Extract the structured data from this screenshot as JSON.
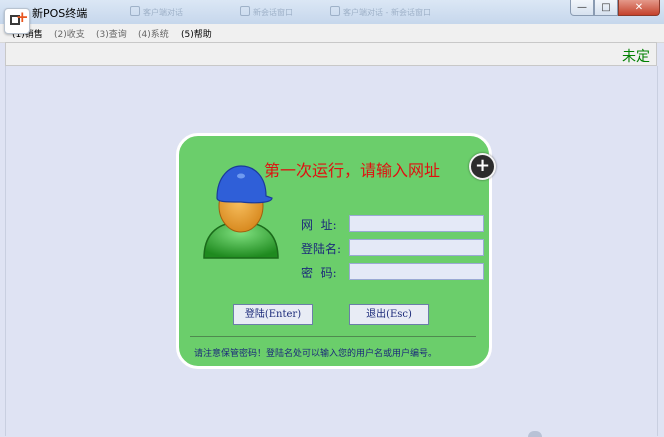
{
  "window": {
    "title": "新POS终端",
    "ghost_tabs": [
      "客户端对话",
      "新会话窗口",
      "客户端对话 - 新会话窗口",
      "客户端对话 - 新会话窗口"
    ],
    "controls": {
      "minimize": "—",
      "maximize": "□",
      "close": "✕"
    }
  },
  "menu": {
    "items": [
      "(1)销售",
      "(2)收支",
      "(3)查询",
      "(4)系统",
      "(5)帮助"
    ]
  },
  "status": {
    "text": "未定"
  },
  "login": {
    "title": "第一次运行，请输入网址",
    "fields": {
      "url_label": "网  址:",
      "url_value": "",
      "username_label": "登陆名:",
      "username_value": "",
      "password_label": "密  码:",
      "password_value": ""
    },
    "login_button": "登陆(Enter)",
    "exit_button": "退出(Esc)",
    "notice": "请注意保管密码！登陆名处可以输入您的用户名或用户编号。",
    "add_button": "+"
  },
  "colors": {
    "card_bg": "#6bce6b",
    "title_red": "#e01010",
    "status_green": "#008000",
    "label_blue": "#1b2a7a"
  }
}
